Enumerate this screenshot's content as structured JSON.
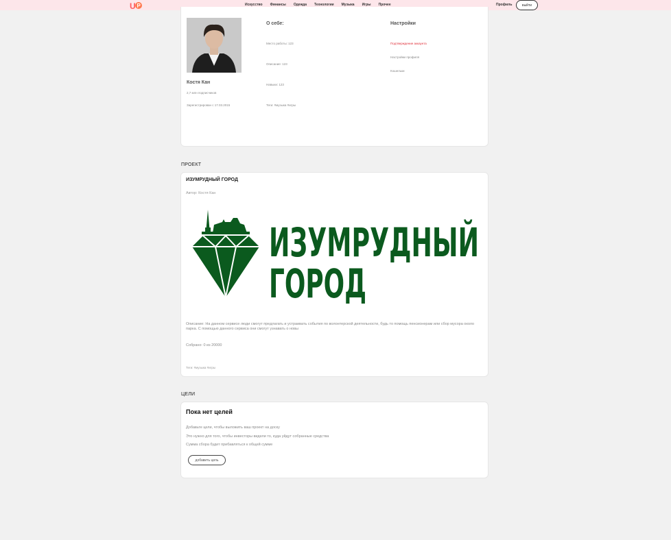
{
  "nav": {
    "logo_text": "UP",
    "items": [
      "Искусство",
      "Финансы",
      "Одежда",
      "Технологии",
      "Музыка",
      "Игры",
      "Прочее"
    ],
    "profile_label": "Профиль",
    "logout_label": "выйти"
  },
  "profile": {
    "name": "Костя Кан",
    "subscribers": "2,7 млн подписчиков",
    "registered": "Зарегистрирован с 17.03.2015",
    "about_title": "О себе:",
    "about_items": [
      "Место работы: 123",
      "Описание: 123",
      "Навыки: 123",
      "Теги: #музыка #игры"
    ],
    "settings_title": "Настройки",
    "settings_items": [
      "Подтверждение аккаунта",
      "Настройки профиля",
      "Кошельки"
    ]
  },
  "project_section": {
    "heading": "ПРОЕКТ",
    "title": "ИЗУМРУДНЫЙ ГОРОД",
    "author": "Автор: Костя Кан",
    "logo_line1": "ИЗУМРУДНЫЙ",
    "logo_line2": "ГОРОД",
    "description": "Описание: На данном сервисе люди смогут предлагать и устраивать события по волонтерской деятельности, будь то помощь пенсионерам или сбор мусора около парка. С помощью данного сервиса они смогут узнавать о новы",
    "collected": "Собрано: 0 из 20000",
    "tags": "Теги: #музыка #игры",
    "logo_color": "#0b5a1e"
  },
  "goals_section": {
    "heading": "ЦЕЛИ",
    "title": "Пока нет целей",
    "lines": [
      "Добавьте цели, чтобы выложить ваш проект на доску",
      "Это нужно для того, чтобы инвесторы видели то, куда уйдут собранные средства",
      "Сумма сбора будет прибавляться к общей сумме"
    ],
    "add_button": "добавить цель"
  }
}
